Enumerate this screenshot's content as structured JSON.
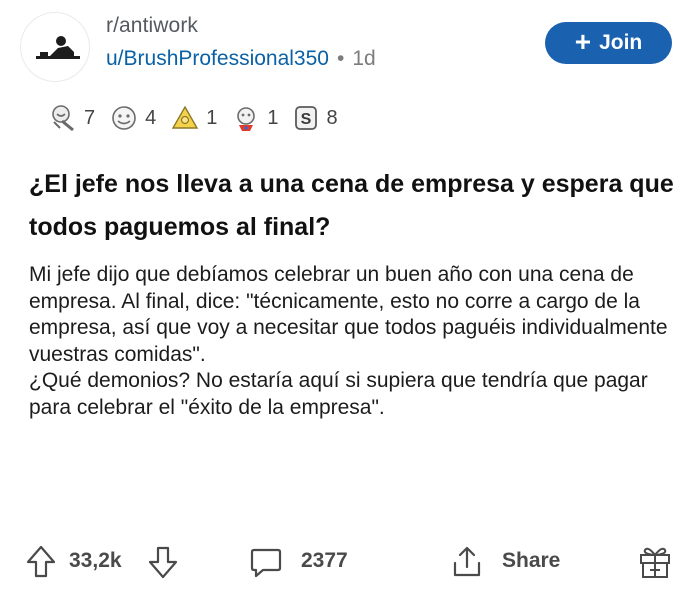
{
  "post": {
    "subreddit": "r/antiwork",
    "username": "u/BrushProfessional350",
    "separator": "•",
    "age": "1d",
    "join_label": "Join",
    "join_icon": "plus-icon",
    "awards": [
      {
        "icon": "helpful-award-icon",
        "count": "7"
      },
      {
        "icon": "wholesome-award-icon",
        "count": "4"
      },
      {
        "icon": "gold-award-icon",
        "count": "1"
      },
      {
        "icon": "superhero-award-icon",
        "count": "1"
      },
      {
        "icon": "silver-coin-award-icon",
        "count": "8"
      }
    ],
    "title": "¿El jefe nos lleva a una cena de empresa y espera que todos paguemos al final?",
    "body_paragraph_1": "Mi jefe dijo que debíamos celebrar un buen año con una cena de empresa. Al final, dice: \"técnicamente, esto no corre a cargo de la empresa, así que voy a necesitar que todos paguéis individualmente vuestras comidas\".",
    "body_paragraph_2": "¿Qué demonios? No estaría aquí si supiera que tendría que pagar para celebrar el \"éxito de la empresa\"."
  },
  "footer": {
    "upvote_count": "33,2k",
    "comment_count": "2377",
    "share_label": "Share"
  },
  "colors": {
    "join_button": "#1a61b0",
    "username": "#0b61a5",
    "text": "#1c1c1c",
    "muted": "#7c7c7c"
  }
}
